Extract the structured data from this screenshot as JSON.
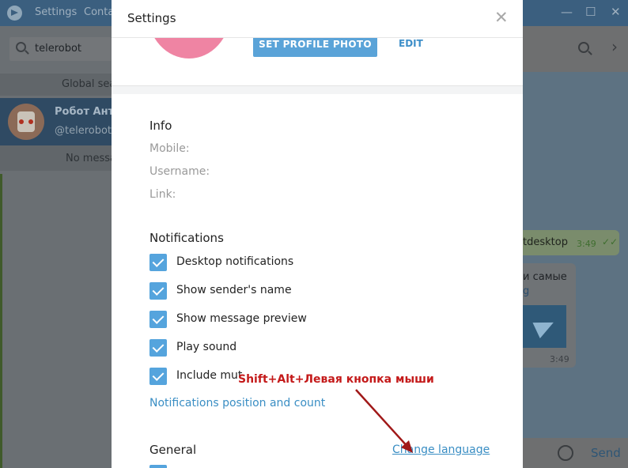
{
  "background_app": {
    "menu": [
      "Settings",
      "Conta"
    ],
    "window_controls": [
      "—",
      "☐",
      "✕"
    ],
    "search": {
      "value": "telerobot"
    },
    "global_search_label": "Global sea",
    "chat": {
      "name": "Робот Анто",
      "username": "@telerobot"
    },
    "no_messages_label": "No messa",
    "messages": {
      "outgoing_text": "tdesktop",
      "outgoing_time": "3:49",
      "incoming_text": "и самые",
      "incoming_link": "g",
      "incoming_time": "3:49"
    },
    "send_label": "Send"
  },
  "settings": {
    "title": "Settings",
    "set_photo_label": "SET PROFILE PHOTO",
    "edit_label": "EDIT",
    "info": {
      "title": "Info",
      "mobile_label": "Mobile:",
      "username_label": "Username:",
      "link_label": "Link:"
    },
    "notifications": {
      "title": "Notifications",
      "options": [
        {
          "label": "Desktop notifications",
          "checked": true
        },
        {
          "label": "Show sender's name",
          "checked": true
        },
        {
          "label": "Show message preview",
          "checked": true
        },
        {
          "label": "Play sound",
          "checked": true
        },
        {
          "label": "Include mut",
          "checked": true
        }
      ],
      "position_link": "Notifications position and count"
    },
    "general": {
      "title": "General",
      "change_language": "Change language"
    }
  },
  "annotation": {
    "text": "Shift+Alt+Левая кнопка мыши",
    "color": "#c41a1a"
  },
  "colors": {
    "accent": "#55a4dd",
    "link": "#3a8ec4",
    "avatar": "#ef84a3"
  }
}
